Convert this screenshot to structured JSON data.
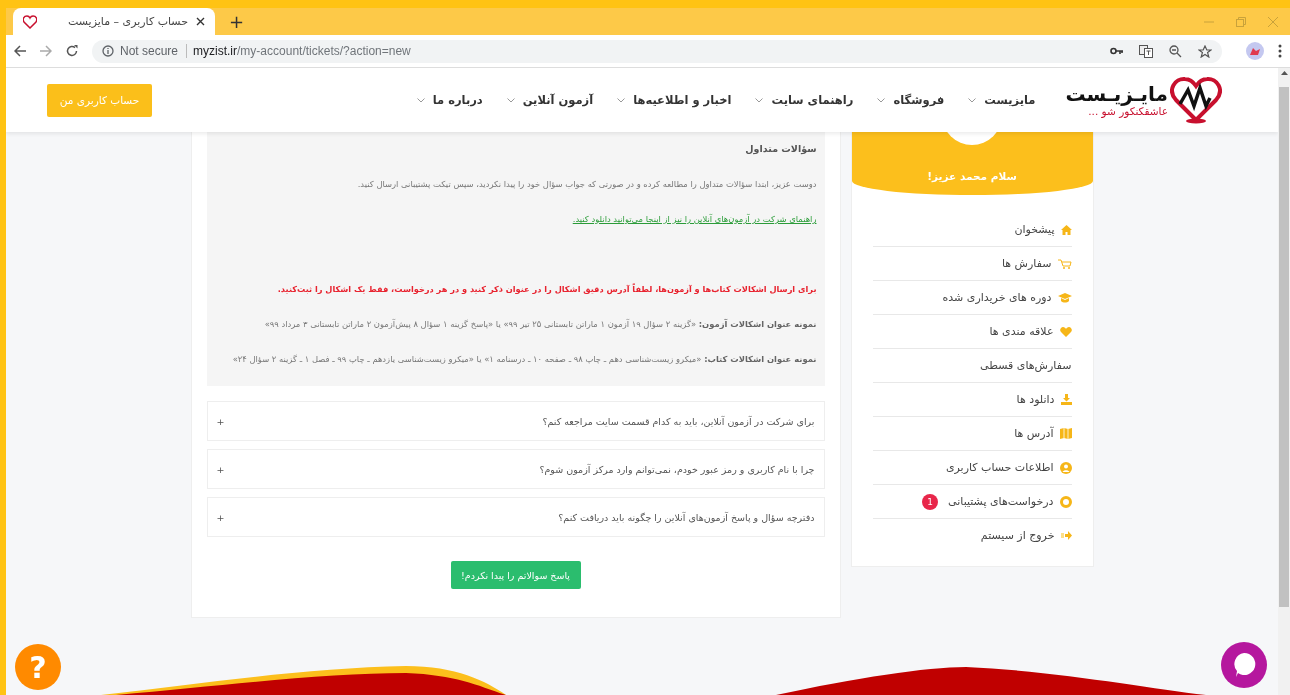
{
  "browser": {
    "tab_title": "حساب کاربری – مایزیست",
    "new_tab": "+",
    "security": "Not secure",
    "domain": "myzist.ir",
    "path": "/my-account/tickets/?action=new"
  },
  "header": {
    "logo_title": "مایـزیـست",
    "logo_tagline": "عاشقکنکور شو ...",
    "nav": [
      {
        "label": "مایزیست"
      },
      {
        "label": "فروشگاه"
      },
      {
        "label": "راهنمای سایت"
      },
      {
        "label": "اخبار و اطلاعیه‌ها"
      },
      {
        "label": "آزمون آنلاین"
      },
      {
        "label": "درباره ما"
      }
    ],
    "account_button": "حساب کاربری من"
  },
  "faq": {
    "title": "سؤالات متداول",
    "intro": "دوست عزیز، ابتدا سؤالات متداول را مطالعه کرده و در صورتی که جواب سؤال خود را پیدا نکردید، سپس تیکت پشتیبانی ارسال کنید.",
    "guide_link": "راهنمای شرکت در آزمون‌های آنلاین را نیز از اینجا می‌توانید دانلود کنید.",
    "notice": "برای ارسال اشکالات کتاب‌ها و آزمون‌ها، لطفاً آدرس دقیق اشکال را در عنوان ذکر کنید و در هر درخواست، فقط یک اشکال را ثبت‌کنید.",
    "examples": [
      "**نمونه عنوان اشکالات آزمون:** «گزینه ۲ سؤال ۱۹ آزمون ۱ ماراتن تابستانی ۲۵ تیر ۹۹» یا «پاسخ گزینه ۱ سؤال ۸ پیش‌آزمون ۲ ماراتن تابستانی ۳ مرداد ۹۹»",
      "**نمونه عنوان اشکالات کتاب:** «میکرو زیست‌شناسی دهم ـ چاپ ۹۸ ـ صفحه ۱۰ ـ درسنامه ۱» یا «میکرو زیست‌شناسی یازدهم ـ چاپ ۹۹ ـ فصل ۱ ـ گزینه ۲ سؤال ۲۴»"
    ],
    "questions": [
      {
        "question": "برای شرکت در آزمون آنلاین، باید به کدام قسمت سایت مراجعه کنم؟",
        "toggle": "+",
        "expanded": false
      },
      {
        "question": "چرا با نام کاربری و رمز عبور خودم، نمی‌توانم وارد مرکز آزمون شوم؟",
        "toggle": "+",
        "expanded": false
      },
      {
        "question": "دفترچه سؤال و پاسخ آزمون‌های آنلاین را چگونه باید دریافت کنم؟",
        "toggle": "+",
        "expanded": false
      }
    ],
    "not_found_button": "پاسخ سوالاتم را پیدا نکردم!"
  },
  "sidebar": {
    "greeting": "سلام محمد عزیز!",
    "menu": [
      {
        "label": "پیشخوان",
        "kind": "home"
      },
      {
        "label": "سفارش ها",
        "kind": "cart"
      },
      {
        "label": "دوره های خریداری شده",
        "kind": "course"
      },
      {
        "label": "علاقه مندی ها",
        "kind": "heart"
      },
      {
        "label": "سفارش‌های قسطی",
        "kind": "plain"
      },
      {
        "label": "دانلود ها",
        "kind": "download"
      },
      {
        "label": "آدرس ها",
        "kind": "map"
      },
      {
        "label": "اطلاعات حساب کاربری",
        "kind": "user"
      },
      {
        "label": "درخواست‌های پشتیبانی",
        "kind": "support",
        "badge": "1"
      },
      {
        "label": "خروج از سیستم",
        "kind": "exit"
      }
    ]
  },
  "help_button": "?"
}
